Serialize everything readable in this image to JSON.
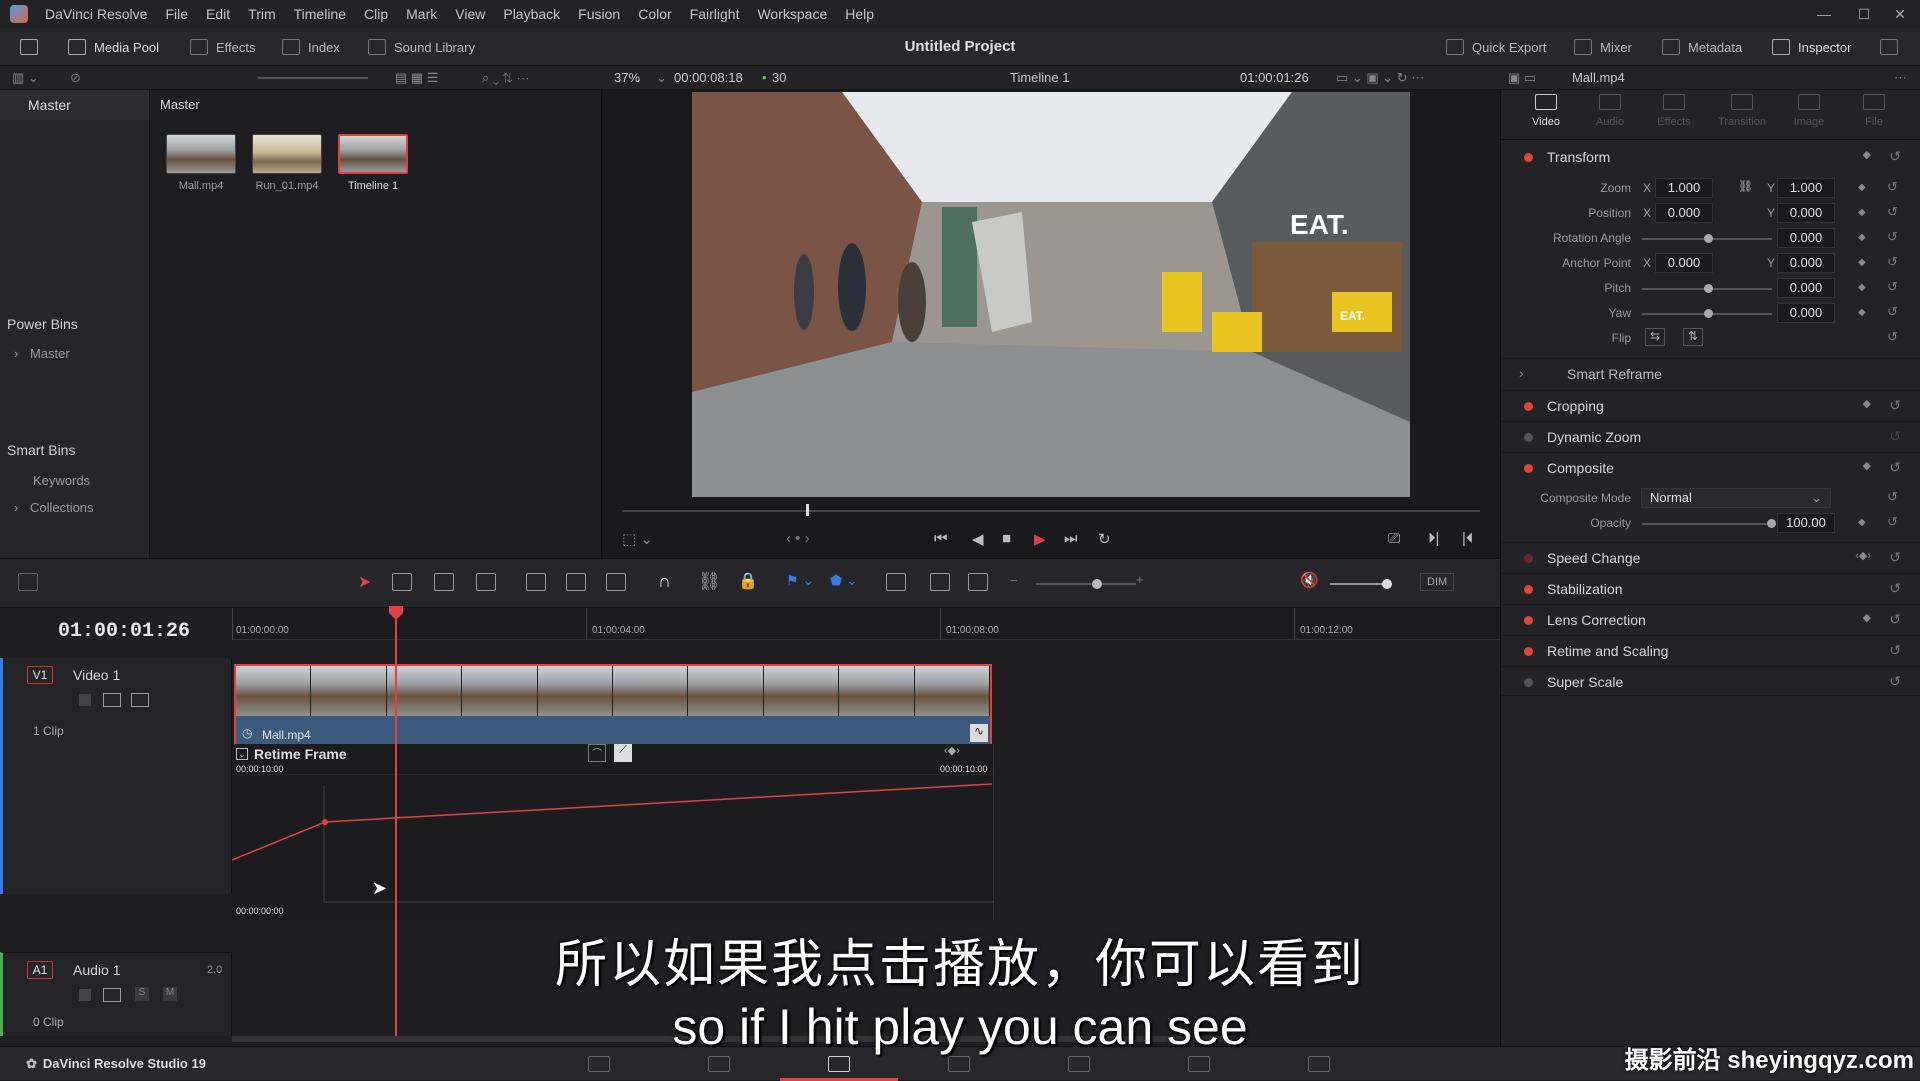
{
  "menubar": {
    "app_name": "DaVinci Resolve",
    "items": [
      "File",
      "Edit",
      "Trim",
      "Timeline",
      "Clip",
      "Mark",
      "View",
      "Playback",
      "Fusion",
      "Color",
      "Fairlight",
      "Workspace",
      "Help"
    ]
  },
  "toolbar": {
    "media_pool": "Media Pool",
    "effects": "Effects",
    "index": "Index",
    "sound_library": "Sound Library",
    "project_title": "Untitled Project",
    "quick_export": "Quick Export",
    "mixer": "Mixer",
    "metadata": "Metadata",
    "inspector": "Inspector"
  },
  "viewer_bar": {
    "zoom": "37%",
    "duration": "00:00:08:18",
    "fps": "30",
    "timeline_name": "Timeline 1",
    "timecode": "01:00:01:26",
    "clip_name": "Mall.mp4"
  },
  "bins": {
    "master_header": "Master",
    "power_bins": "Power Bins",
    "power_master": "Master",
    "smart_bins": "Smart Bins",
    "keywords": "Keywords",
    "collections": "Collections"
  },
  "media_pool": {
    "header": "Master",
    "clips": [
      "Mall.mp4",
      "Run_01.mp4",
      "Timeline 1"
    ]
  },
  "viewer": {
    "sign_text": "EAT.",
    "kiosk_text": "EAT."
  },
  "inspector": {
    "tabs": [
      "Video",
      "Audio",
      "Effects",
      "Transition",
      "Image",
      "File"
    ],
    "transform": "Transform",
    "zoom_label": "Zoom",
    "zoom_x": "1.000",
    "zoom_y": "1.000",
    "position_label": "Position",
    "position_x": "0.000",
    "position_y": "0.000",
    "rotation_label": "Rotation Angle",
    "rotation": "0.000",
    "anchor_label": "Anchor Point",
    "anchor_x": "0.000",
    "anchor_y": "0.000",
    "pitch_label": "Pitch",
    "pitch": "0.000",
    "yaw_label": "Yaw",
    "yaw": "0.000",
    "flip_label": "Flip",
    "x_axis": "X",
    "y_axis": "Y",
    "smart_reframe": "Smart Reframe",
    "cropping": "Cropping",
    "dynamic_zoom": "Dynamic Zoom",
    "composite": "Composite",
    "composite_mode_label": "Composite Mode",
    "composite_mode": "Normal",
    "opacity_label": "Opacity",
    "opacity": "100.00",
    "speed_change": "Speed Change",
    "stabilization": "Stabilization",
    "lens_correction": "Lens Correction",
    "retime_scaling": "Retime and Scaling",
    "super_scale": "Super Scale"
  },
  "timeline": {
    "timecode": "01:00:01:26",
    "ruler": [
      "01:00:00:00",
      "01:00:04:00",
      "01:00:08:00",
      "01:00:12:00"
    ],
    "video_track_id": "V1",
    "video_track_name": "Video 1",
    "video_clip_count": "1 Clip",
    "clip_name": "Mall.mp4",
    "retime_title": "Retime Frame",
    "retime_start": "00:00:10:00",
    "retime_end": "00:00:10:00",
    "retime_zero": "00:00:00:00",
    "audio_track_id": "A1",
    "audio_track_name": "Audio 1",
    "audio_channels": "2.0",
    "audio_clip_count": "0 Clip",
    "solo": "S",
    "mute": "M",
    "dim": "DIM"
  },
  "bottombar": {
    "brand": "DaVinci Resolve Studio 19"
  },
  "subtitles": {
    "zh": "所以如果我点击播放，你可以看到",
    "en": "so if I hit play you can see"
  },
  "watermark": "摄影前沿 sheyingqyz.com",
  "colors": {
    "accent_red": "#e0404a",
    "clip_blue": "#3c5a7c",
    "panel_bg": "#232326"
  }
}
